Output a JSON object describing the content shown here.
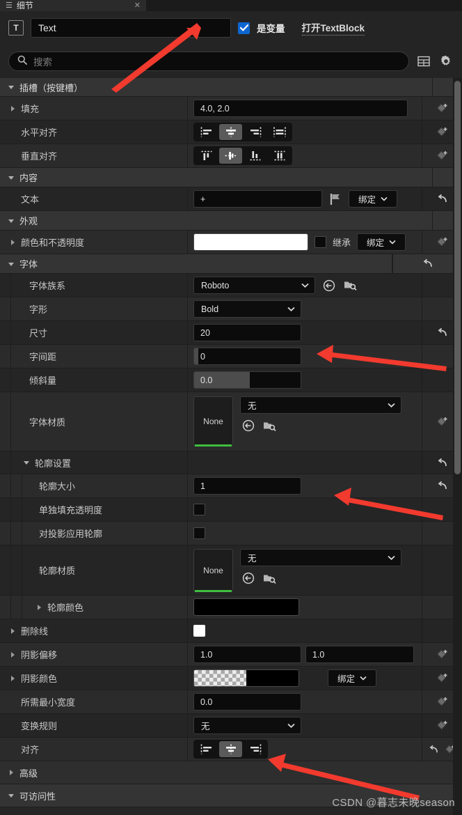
{
  "panel": {
    "tab_title": "细节",
    "tab_icon": "details-icon",
    "close_icon": "close-icon"
  },
  "header": {
    "widget_icon": "text-widget-icon",
    "name_value": "Text",
    "is_variable_label": "是变量",
    "is_variable_checked": true,
    "open_link_label": "打开TextBlock"
  },
  "search": {
    "placeholder": "搜索",
    "icon": "search-icon",
    "view_options_icon": "table-view-icon",
    "settings_icon": "gear-icon"
  },
  "sections": [
    {
      "id": "slot",
      "label": "插槽（按键槽）",
      "expanded": true
    },
    {
      "id": "content",
      "label": "内容",
      "expanded": true
    },
    {
      "id": "appear",
      "label": "外观",
      "expanded": true
    },
    {
      "id": "font",
      "label": "字体",
      "expanded": true
    },
    {
      "id": "outline",
      "label": "轮廓设置",
      "expanded": true
    },
    {
      "id": "advanced",
      "label": "高级",
      "expanded": false
    },
    {
      "id": "access",
      "label": "可访问性",
      "expanded": true
    }
  ],
  "rows": {
    "padding": {
      "label": "填充",
      "value": "4.0, 2.0"
    },
    "h_align": {
      "label": "水平对齐",
      "selected": 1,
      "options": [
        "left",
        "center",
        "right",
        "fill"
      ]
    },
    "v_align": {
      "label": "垂直对齐",
      "selected": 1,
      "options": [
        "top",
        "center",
        "bottom",
        "fill"
      ]
    },
    "text": {
      "label": "文本",
      "value": "+",
      "flag_icon": "localization-flag-icon",
      "bind_label": "绑定",
      "reset_icon": "reset-arrow-icon"
    },
    "color_opacity": {
      "label": "颜色和不透明度",
      "swatch": "#ffffff",
      "inherit_label": "继承",
      "inherit_checked": false,
      "bind_label": "绑定"
    },
    "font_family": {
      "label": "字体族系",
      "value": "Roboto",
      "use_selected_icon": "use-selected-asset-icon",
      "browse_icon": "browse-asset-icon"
    },
    "typeface": {
      "label": "字形",
      "value": "Bold"
    },
    "size": {
      "label": "尺寸",
      "value": "20"
    },
    "letter_spacing": {
      "label": "字间距",
      "value": "0",
      "fill_pct": 4
    },
    "skew": {
      "label": "倾斜量",
      "value": "0.0",
      "fill_pct": 52
    },
    "font_material": {
      "label": "字体材质",
      "thumb_label": "None",
      "value": "无",
      "use_selected_icon": "use-selected-asset-icon",
      "browse_icon": "browse-asset-icon"
    },
    "outline_size": {
      "label": "轮廓大小",
      "value": "1"
    },
    "separate_fill": {
      "label": "单独填充透明度",
      "checked": false
    },
    "apply_to_shadow": {
      "label": "对投影应用轮廓",
      "checked": false
    },
    "outline_material": {
      "label": "轮廓材质",
      "thumb_label": "None",
      "value": "无",
      "use_selected_icon": "use-selected-asset-icon",
      "browse_icon": "browse-asset-icon"
    },
    "outline_color": {
      "label": "轮廓颜色",
      "swatch": "#000000"
    },
    "strike": {
      "label": "删除线",
      "swatch": "#ffffff"
    },
    "shadow_offset": {
      "label": "阴影偏移",
      "x": "1.0",
      "y": "1.0"
    },
    "shadow_color": {
      "label": "阴影颜色",
      "bind_label": "绑定"
    },
    "min_width": {
      "label": "所需最小宽度",
      "value": "0.0"
    },
    "transform": {
      "label": "变换规则",
      "value": "无"
    },
    "justification": {
      "label": "对齐",
      "selected": 1,
      "options": [
        "left",
        "center",
        "right"
      ],
      "reset_icon": "reset-arrow-icon"
    }
  },
  "colors": {
    "accent_blue": "#0d66d0",
    "asset_green": "#3fbf3f",
    "arrow_red": "#f23a2e",
    "panel_bg": "#262626",
    "category_bg": "#343434"
  },
  "watermark": "CSDN @暮志未晚season"
}
